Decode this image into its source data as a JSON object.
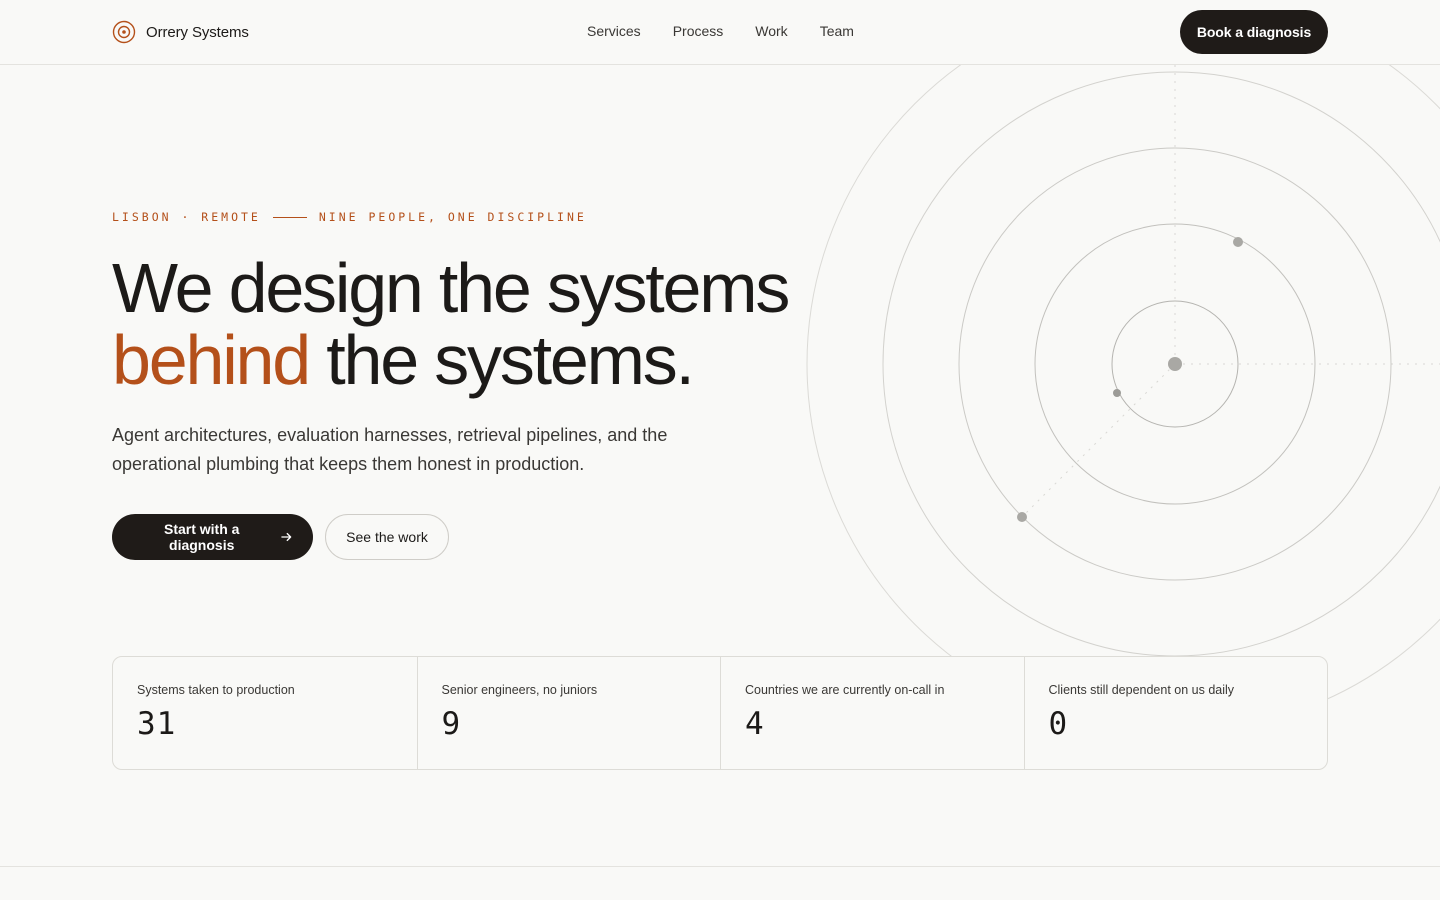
{
  "brand": {
    "name": "Orrery Systems",
    "accent": "#b4501a"
  },
  "nav": {
    "items": [
      {
        "label": "Services"
      },
      {
        "label": "Process"
      },
      {
        "label": "Work"
      },
      {
        "label": "Team"
      }
    ],
    "cta_label": "Book a diagnosis"
  },
  "hero": {
    "eyebrow_left": "LISBON · REMOTE",
    "eyebrow_right": "NINE PEOPLE, ONE DISCIPLINE",
    "headline_line1": "We design the systems",
    "headline_accent": "behind",
    "headline_rest": " the systems.",
    "subcopy": "Agent architectures, evaluation harnesses, retrieval pipelines, and the operational plumbing that keeps them honest in production.",
    "primary_cta": "Start with a diagnosis",
    "primary_cta_icon": "arrow-right-icon",
    "secondary_cta": "See the work"
  },
  "stats": [
    {
      "label": "Systems taken to production",
      "value": "31"
    },
    {
      "label": "Senior engineers, no juniors",
      "value": "9"
    },
    {
      "label": "Countries we are currently on-call in",
      "value": "4"
    },
    {
      "label": "Clients still dependent on us daily",
      "value": "0"
    }
  ],
  "colors": {
    "background": "#f9f9f7",
    "text": "#1c1a18",
    "dark_button": "#1f1b18",
    "orbit_stroke": "#c9c8c4"
  }
}
